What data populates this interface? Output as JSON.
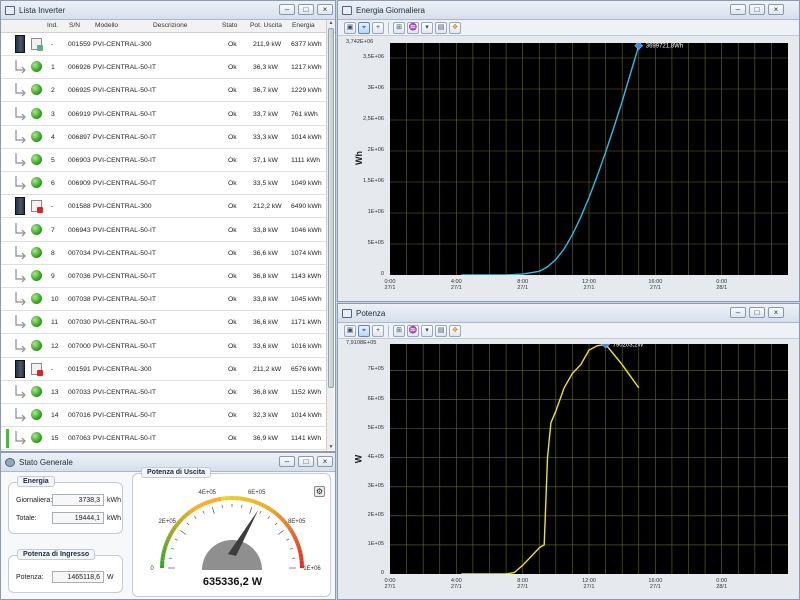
{
  "inverter_window": {
    "title": "Lista Inverter",
    "columns": [
      "Ind.",
      "S/N",
      "Modello",
      "Descrizione",
      "Stato",
      "Pot. Uscita",
      "Energia"
    ],
    "rows": [
      {
        "kind": "central",
        "icon": "doc",
        "ind": "-",
        "sn": "001559",
        "model": "PVI-CENTRAL-300",
        "desc": "",
        "state": "Ok",
        "power": "211,9 kW",
        "energy": "6377 kWh"
      },
      {
        "kind": "sub",
        "icon": "ok",
        "ind": "1",
        "sn": "006926",
        "model": "PVI-CENTRAL-50-IT",
        "desc": "",
        "state": "Ok",
        "power": "36,3 kW",
        "energy": "1217 kWh"
      },
      {
        "kind": "sub",
        "icon": "ok",
        "ind": "2",
        "sn": "006925",
        "model": "PVI-CENTRAL-50-IT",
        "desc": "",
        "state": "Ok",
        "power": "36,7 kW",
        "energy": "1229 kWh"
      },
      {
        "kind": "sub",
        "icon": "ok",
        "ind": "3",
        "sn": "006919",
        "model": "PVI-CENTRAL-50-IT",
        "desc": "",
        "state": "Ok",
        "power": "33,7 kW",
        "energy": "761 kWh"
      },
      {
        "kind": "sub",
        "icon": "ok",
        "ind": "4",
        "sn": "006897",
        "model": "PVI-CENTRAL-50-IT",
        "desc": "",
        "state": "Ok",
        "power": "33,3 kW",
        "energy": "1014 kWh"
      },
      {
        "kind": "sub",
        "icon": "ok",
        "ind": "5",
        "sn": "006903",
        "model": "PVI-CENTRAL-50-IT",
        "desc": "",
        "state": "Ok",
        "power": "37,1 kW",
        "energy": "1111 kWh"
      },
      {
        "kind": "sub",
        "icon": "ok",
        "ind": "6",
        "sn": "006909",
        "model": "PVI-CENTRAL-50-IT",
        "desc": "",
        "state": "Ok",
        "power": "33,5 kW",
        "energy": "1049 kWh"
      },
      {
        "kind": "central",
        "icon": "red",
        "ind": "-",
        "sn": "001588",
        "model": "PVI-CENTRAL-300",
        "desc": "",
        "state": "Ok",
        "power": "212,2 kW",
        "energy": "6490 kWh"
      },
      {
        "kind": "sub",
        "icon": "ok",
        "ind": "7",
        "sn": "006943",
        "model": "PVI-CENTRAL-50-IT",
        "desc": "",
        "state": "Ok",
        "power": "33,8 kW",
        "energy": "1046 kWh"
      },
      {
        "kind": "sub",
        "icon": "ok",
        "ind": "8",
        "sn": "007034",
        "model": "PVI-CENTRAL-50-IT",
        "desc": "",
        "state": "Ok",
        "power": "36,6 kW",
        "energy": "1074 kWh"
      },
      {
        "kind": "sub",
        "icon": "ok",
        "ind": "9",
        "sn": "007036",
        "model": "PVI-CENTRAL-50-IT",
        "desc": "",
        "state": "Ok",
        "power": "36,8 kW",
        "energy": "1143 kWh"
      },
      {
        "kind": "sub",
        "icon": "ok",
        "ind": "10",
        "sn": "007038",
        "model": "PVI-CENTRAL-50-IT",
        "desc": "",
        "state": "Ok",
        "power": "33,8 kW",
        "energy": "1045 kWh"
      },
      {
        "kind": "sub",
        "icon": "ok",
        "ind": "11",
        "sn": "007030",
        "model": "PVI-CENTRAL-50-IT",
        "desc": "",
        "state": "Ok",
        "power": "36,6 kW",
        "energy": "1171 kWh"
      },
      {
        "kind": "sub",
        "icon": "ok",
        "ind": "12",
        "sn": "007000",
        "model": "PVI-CENTRAL-50-IT",
        "desc": "",
        "state": "Ok",
        "power": "33,6 kW",
        "energy": "1016 kWh"
      },
      {
        "kind": "central",
        "icon": "red",
        "ind": "-",
        "sn": "001591",
        "model": "PVI-CENTRAL-300",
        "desc": "",
        "state": "Ok",
        "power": "211,2 kW",
        "energy": "6576 kWh"
      },
      {
        "kind": "sub",
        "icon": "ok",
        "ind": "13",
        "sn": "007033",
        "model": "PVI-CENTRAL-50-IT",
        "desc": "",
        "state": "Ok",
        "power": "36,8 kW",
        "energy": "1152 kWh"
      },
      {
        "kind": "sub",
        "icon": "ok",
        "ind": "14",
        "sn": "007016",
        "model": "PVI-CENTRAL-50-IT",
        "desc": "",
        "state": "Ok",
        "power": "32,3 kW",
        "energy": "1014 kWh"
      },
      {
        "kind": "sub",
        "icon": "ok",
        "ind": "15",
        "sn": "007063",
        "model": "PVI-CENTRAL-50-IT",
        "desc": "",
        "state": "Ok",
        "power": "36,9 kW",
        "energy": "1141 kWh"
      }
    ]
  },
  "stato_window": {
    "title": "Stato Generale",
    "energia": {
      "label": "Energia",
      "daily_label": "Giornaliera:",
      "daily_value": "3738,3",
      "daily_unit": "kWh",
      "total_label": "Totale:",
      "total_value": "19444,1",
      "total_unit": "kWh"
    },
    "ingresso": {
      "label": "Potenza di Ingresso",
      "power_label": "Potenza:",
      "power_value": "1465118,6",
      "power_unit": "W"
    },
    "uscita": {
      "label": "Potenza di Uscita",
      "ticks": [
        "0",
        "2E+05",
        "4E+05",
        "6E+05",
        "8E+05",
        "1E+06"
      ],
      "reading": "635336,2 W",
      "value": 635336.2,
      "max": 1000000
    }
  },
  "energy_window": {
    "title": "Energia Giornaliera",
    "y_label": "Wh",
    "top_label": "3,742E+06",
    "marker_label": "3699721,8Wh",
    "y_ticks": [
      "3,5E+06",
      "3E+06",
      "2,5E+06",
      "2E+06",
      "1,5E+06",
      "1E+06",
      "5E+05",
      "0"
    ],
    "x_ticks": [
      [
        "0:00",
        "27/1"
      ],
      [
        "4:00",
        "27/1"
      ],
      [
        "8:00",
        "27/1"
      ],
      [
        "12:00",
        "27/1"
      ],
      [
        "16:00",
        "27/1"
      ],
      [
        "0:00",
        "28/1"
      ]
    ]
  },
  "power_window": {
    "title": "Potenza",
    "y_label": "W",
    "top_label": "7,9108E+05",
    "marker_label": "790203,2W",
    "y_ticks": [
      "7E+05",
      "6E+05",
      "5E+05",
      "4E+05",
      "3E+05",
      "2E+05",
      "1E+05",
      "0"
    ],
    "x_ticks": [
      [
        "0:00",
        "27/1"
      ],
      [
        "4:00",
        "27/1"
      ],
      [
        "8:00",
        "27/1"
      ],
      [
        "12:00",
        "27/1"
      ],
      [
        "16:00",
        "27/1"
      ],
      [
        "0:00",
        "28/1"
      ]
    ]
  },
  "colors": {
    "energy_line": "#2bbde8",
    "power_line": "#f2e21b",
    "grid": "#6b6b1e",
    "marker": "#3a8cf0"
  },
  "chart_data": [
    {
      "type": "line",
      "title": "Energia Giornaliera",
      "ylabel": "Wh",
      "xlabel": "",
      "x_range_hours": [
        0,
        24
      ],
      "ylim": [
        0,
        3742000
      ],
      "grid": true,
      "x": [
        6.5,
        7,
        8,
        9,
        9.5,
        10,
        10.5,
        11,
        11.5,
        12,
        12.5,
        13,
        13.5,
        14,
        14.5,
        15
      ],
      "series": [
        {
          "values": [
            0,
            2000,
            15000,
            60000,
            130000,
            250000,
            420000,
            650000,
            930000,
            1250000,
            1600000,
            1980000,
            2380000,
            2800000,
            3250000,
            3699721.8
          ]
        }
      ]
    },
    {
      "type": "line",
      "title": "Potenza",
      "ylabel": "W",
      "xlabel": "",
      "x_range_hours": [
        0,
        24
      ],
      "ylim": [
        0,
        791080
      ],
      "grid": true,
      "x": [
        6.5,
        7,
        7.5,
        8,
        8.5,
        9,
        9.3,
        9.5,
        9.7,
        10,
        10.5,
        11,
        11.5,
        12,
        12.5,
        13,
        13.5,
        14,
        14.5,
        15
      ],
      "series": [
        {
          "values": [
            0,
            0,
            5000,
            30000,
            60000,
            90000,
            100000,
            400000,
            520000,
            560000,
            640000,
            690000,
            720000,
            770000,
            785000,
            790203.2,
            755000,
            720000,
            680000,
            640000
          ]
        }
      ]
    }
  ]
}
